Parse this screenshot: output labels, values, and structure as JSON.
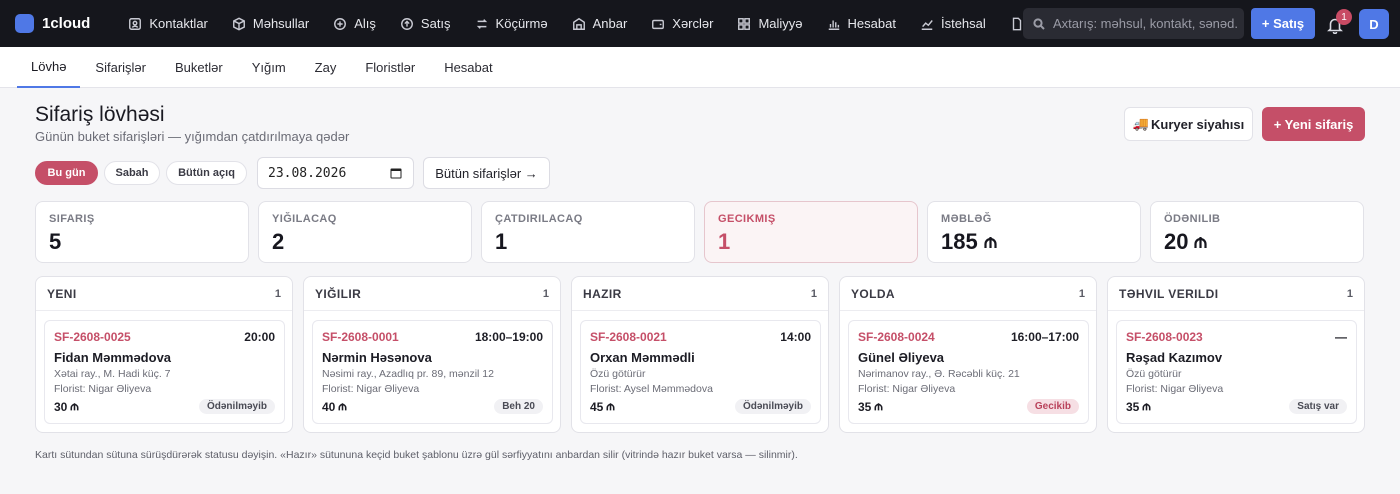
{
  "app": {
    "name": "1cloud"
  },
  "nav": [
    {
      "label": "Kontaktlar",
      "icon": "contacts-icon"
    },
    {
      "label": "Məhsullar",
      "icon": "box-icon"
    },
    {
      "label": "Alış",
      "icon": "plus-circle-icon"
    },
    {
      "label": "Satış",
      "icon": "arrow-up-circle-icon"
    },
    {
      "label": "Köçürmə",
      "icon": "transfer-icon"
    },
    {
      "label": "Anbar",
      "icon": "warehouse-icon"
    },
    {
      "label": "Xərclər",
      "icon": "wallet-icon"
    },
    {
      "label": "Maliyyə",
      "icon": "grid-icon"
    },
    {
      "label": "Hesabat",
      "icon": "bar-chart-icon"
    },
    {
      "label": "İstehsal",
      "icon": "trend-icon"
    }
  ],
  "search": {
    "placeholder": "Axtarış: məhsul, kontakt, sənəd..."
  },
  "topbar": {
    "new_sale_label": "+ Satış",
    "notifications_count": "1",
    "avatar_initial": "D"
  },
  "subtabs": [
    "Lövhə",
    "Sifarişlər",
    "Buketlər",
    "Yığım",
    "Zay",
    "Floristlər",
    "Hesabat"
  ],
  "header": {
    "title": "Sifariş lövhəsi",
    "subtitle": "Günün buket sifarişləri — yığımdan çatdırılmaya qədər",
    "courier_label": "Kuryer siyahısı",
    "new_order_label": "+ Yeni sifariş"
  },
  "filters": {
    "pills": [
      "Bu gün",
      "Sabah",
      "Bütün açıq"
    ],
    "date_value": "23.08.2026",
    "all_orders_label": "Bütün sifarişlər →"
  },
  "stats": [
    {
      "label": "Sifariş",
      "value": "5",
      "currency": false
    },
    {
      "label": "Yığılacaq",
      "value": "2",
      "currency": false
    },
    {
      "label": "Çatdırılacaq",
      "value": "1",
      "currency": false
    },
    {
      "label": "Gecikmiş",
      "value": "1",
      "currency": false
    },
    {
      "label": "Məbləğ",
      "value": "185",
      "currency": true
    },
    {
      "label": "Ödənilib",
      "value": "20",
      "currency": true
    }
  ],
  "columns": [
    {
      "title": "Yeni",
      "count": "1",
      "card": {
        "code": "SF-2608-0025",
        "time": "20:00",
        "name": "Fidan Məmmədova",
        "address": "Xətai ray., M. Hadi küç. 7",
        "florist": "Florist: Nigar Əliyeva",
        "amount": "30",
        "badge": "Ödənilməyib",
        "badge_type": "neutral"
      }
    },
    {
      "title": "Yığılır",
      "count": "1",
      "card": {
        "code": "SF-2608-0001",
        "time": "18:00–19:00",
        "name": "Nərmin Həsənova",
        "address": "Nəsimi ray., Azadlıq pr. 89, mənzil 12",
        "florist": "Florist: Nigar Əliyeva",
        "amount": "40",
        "badge": "Beh 20",
        "badge_type": "neutral"
      }
    },
    {
      "title": "Hazır",
      "count": "1",
      "card": {
        "code": "SF-2608-0021",
        "time": "14:00",
        "name": "Orxan Məmmədli",
        "address": "Özü götürür",
        "florist": "Florist: Aysel Məmmədova",
        "amount": "45",
        "badge": "Ödənilməyib",
        "badge_type": "neutral"
      }
    },
    {
      "title": "Yolda",
      "count": "1",
      "card": {
        "code": "SF-2608-0024",
        "time": "16:00–17:00",
        "name": "Günel Əliyeva",
        "address": "Nərimanov ray., Ə. Rəcəbli küç. 21",
        "florist": "Florist: Nigar Əliyeva",
        "amount": "35",
        "badge": "Gecikib",
        "badge_type": "danger"
      }
    },
    {
      "title": "Təhvil verildi",
      "count": "1",
      "card": {
        "code": "SF-2608-0023",
        "time": "—",
        "name": "Rəşad Kazımov",
        "address": "Özü götürür",
        "florist": "Florist: Nigar Əliyeva",
        "amount": "35",
        "badge": "Satış var",
        "badge_type": "neutral"
      }
    }
  ],
  "footnote": "Kartı sütundan sütuna sürüşdürərək statusu dəyişin. «Hazır» sütununa keçid buket şablonu üzrə gül sərfiyyatını anbardan silir (vitrində hazır buket varsa — silinmir).",
  "colors": {
    "accent": "#4f78e6",
    "brand": "#c54f68",
    "topbar": "#15161c"
  }
}
